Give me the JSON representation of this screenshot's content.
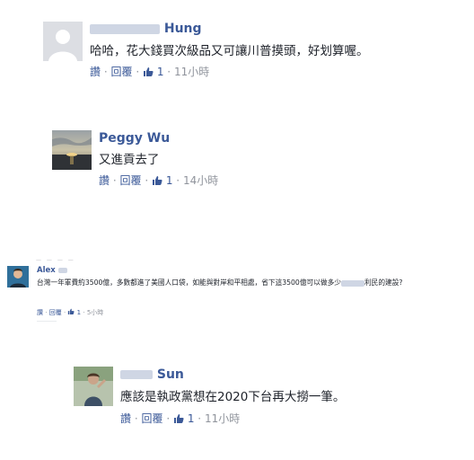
{
  "comments": [
    {
      "name_suffix": "Hung",
      "text": "哈哈，花大錢買次級品又可讓川普摸頭，好划算喔。",
      "like": "讚",
      "reply": "回覆",
      "like_count": "1",
      "time": "11小時"
    },
    {
      "name": "Peggy Wu",
      "text": "又進貢去了",
      "like": "讚",
      "reply": "回覆",
      "like_count": "1",
      "time": "14小時"
    },
    {
      "name_prefix": "Alex",
      "text": "台灣一年軍費約3500億，多數都進了美國人口袋，如能與對岸和平相處，省下這3500億可以做多少",
      "text_tail": "利民的建設?",
      "like": "讚",
      "reply": "回覆",
      "like_count": "1",
      "time": "5小時"
    },
    {
      "name_suffix": "Sun",
      "text": "應該是執政黨想在2020下台再大撈一筆。",
      "like": "讚",
      "reply": "回覆",
      "like_count": "1",
      "time": "11小時"
    }
  ],
  "icons": {
    "like": "thumbs-up-icon",
    "default_avatar": "default-avatar-icon",
    "sunset_avatar": "sunset-photo-avatar",
    "person_avatar": "person-photo-avatar"
  },
  "colors": {
    "name": "#3b5998",
    "text": "#1d2129",
    "muted": "#90949c"
  }
}
